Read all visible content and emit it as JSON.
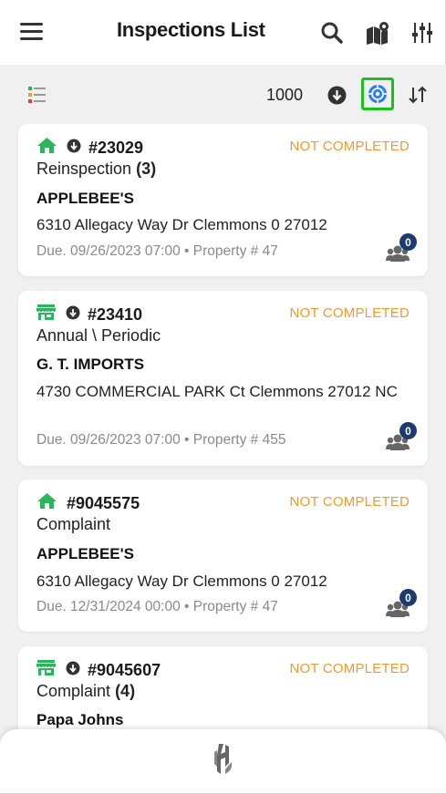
{
  "header": {
    "title": "Inspections List",
    "menu_icon": "hamburger-menu-icon",
    "search_icon": "search-icon",
    "map_icon": "map-pin-icon",
    "filter_icon": "sliders-filter-icon"
  },
  "toolbar": {
    "legend_icon": "color-legend-list-icon",
    "count": "1000",
    "download_icon": "download-circle-icon",
    "locate_icon": "gps-locate-icon",
    "sort_icon": "sort-arrows-icon"
  },
  "colors": {
    "accent_green": "#2bb55c",
    "status_orange": "#f29a2e",
    "badge_navy": "#1e3a6e",
    "locate_blue": "#2f7df6",
    "highlight_green": "#19c219"
  },
  "inspections": [
    {
      "icon": "house-icon",
      "id": "#23029",
      "status": "NOT COMPLETED",
      "type": "Reinspection",
      "type_count": "(3)",
      "name": "APPLEBEE'S",
      "address": "6310 Allegacy Way Dr Clemmons 0 27012",
      "due": "Due. 09/26/2023 07:00",
      "property": "Property # 47",
      "people_count": "0"
    },
    {
      "icon": "storefront-icon",
      "id": "#23410",
      "status": "NOT COMPLETED",
      "type": "Annual \\ Periodic",
      "type_count": "",
      "name": "G. T. IMPORTS",
      "address": "4730 COMMERCIAL PARK Ct Clemmons 27012 NC",
      "due": "Due. 09/26/2023 07:00",
      "property": "Property # 455",
      "people_count": "0"
    },
    {
      "icon": "house-icon",
      "id": "#9045575",
      "status": "NOT COMPLETED",
      "type": "Complaint",
      "type_count": "",
      "name": "APPLEBEE'S",
      "address": "6310 Allegacy Way Dr Clemmons 0 27012",
      "due": "Due. 12/31/2024 00:00",
      "property": "Property # 47",
      "people_count": "0"
    },
    {
      "icon": "storefront-icon",
      "id": "#9045607",
      "status": "NOT COMPLETED",
      "type": "Complaint",
      "type_count": "(4)",
      "name": "Papa Johns"
    }
  ],
  "footer": {
    "logo": "app-logo"
  }
}
